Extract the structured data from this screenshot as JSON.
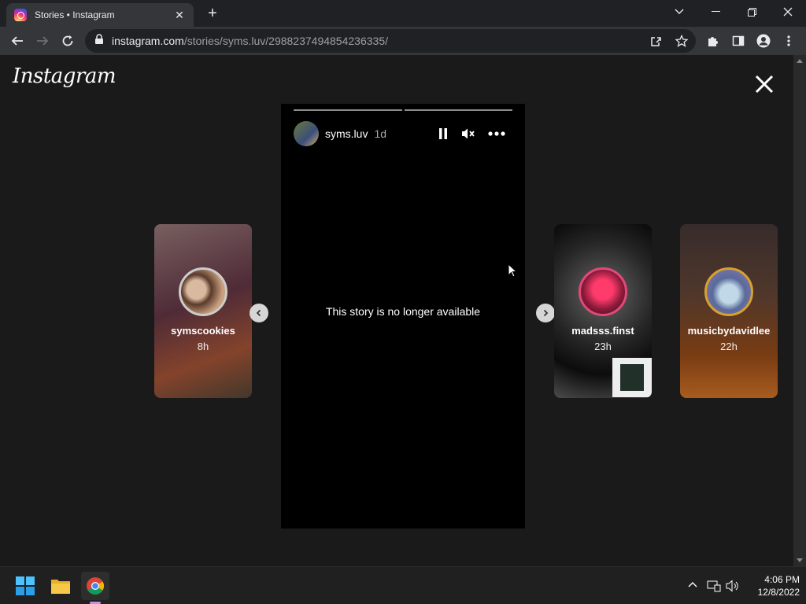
{
  "browser": {
    "tab_title": "Stories • Instagram",
    "url_host": "instagram.com",
    "url_path": "/stories/syms.luv/2988237494854236335/"
  },
  "page": {
    "logo_text": "Instagram",
    "current_story": {
      "username": "syms.luv",
      "time": "1d",
      "message": "This story is no longer available"
    },
    "previews": [
      {
        "username": "symscookies",
        "time": "8h"
      },
      {
        "username": "madsss.finst",
        "time": "23h"
      },
      {
        "username": "musicbydavidlee",
        "time": "22h"
      }
    ]
  },
  "taskbar": {
    "time": "4:06 PM",
    "date": "12/8/2022"
  },
  "colors": {
    "story_ring": "#e04a7a",
    "page_bg": "#1a1a1a"
  }
}
